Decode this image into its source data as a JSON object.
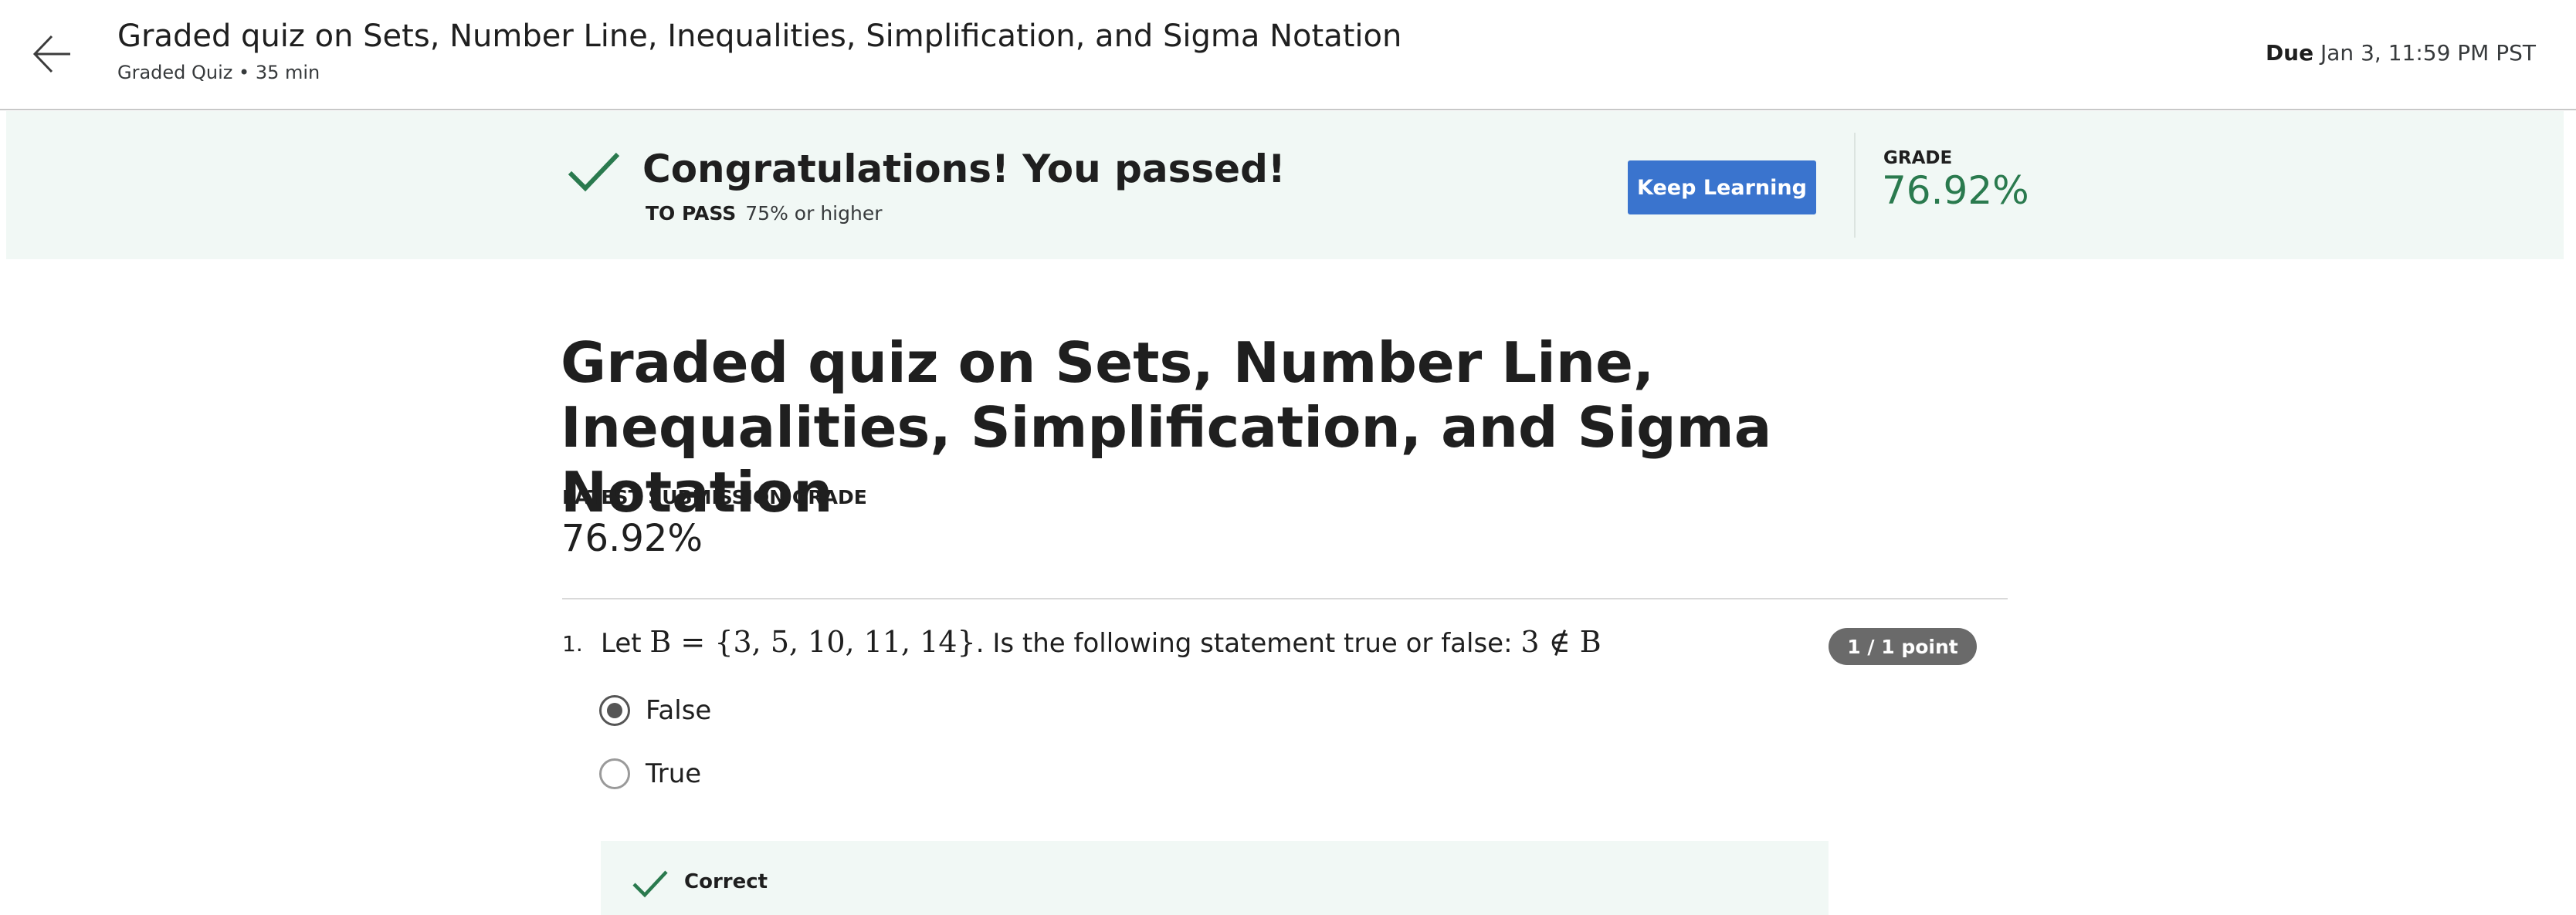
{
  "header": {
    "title": "Graded quiz on Sets, Number Line, Inequalities, Simplification, and Sigma Notation",
    "subtitle": "Graded Quiz • 35 min",
    "due_label": "Due",
    "due_date": "Jan 3, 11:59 PM PST",
    "back_icon": "arrow-left-icon"
  },
  "banner": {
    "message": "Congratulations! You passed!",
    "to_pass_label": "TO PASS",
    "to_pass_value": "75% or higher",
    "keep_learning_label": "Keep Learning",
    "grade_label": "GRADE",
    "grade_value": "76.92%",
    "check_icon": "check-icon",
    "accent_color": "#2a7a4e",
    "button_color": "#3a74ce"
  },
  "main": {
    "title": "Graded quiz on Sets, Number Line, Inequalities, Simplification, and Sigma Notation",
    "latest_grade_label": "LATEST SUBMISSION GRADE",
    "latest_grade_value": "76.92%"
  },
  "questions": [
    {
      "number": "1.",
      "text_prefix": "Let ",
      "math_set": "B = {3, 5, 10, 11, 14}",
      "text_middle": ". Is the following statement true or false: ",
      "math_statement": "3 ∉ B",
      "points": "1 / 1 point",
      "options": [
        {
          "label": "False",
          "selected": true
        },
        {
          "label": "True",
          "selected": false
        }
      ],
      "feedback": {
        "status": "Correct",
        "icon": "check-icon"
      }
    }
  ]
}
